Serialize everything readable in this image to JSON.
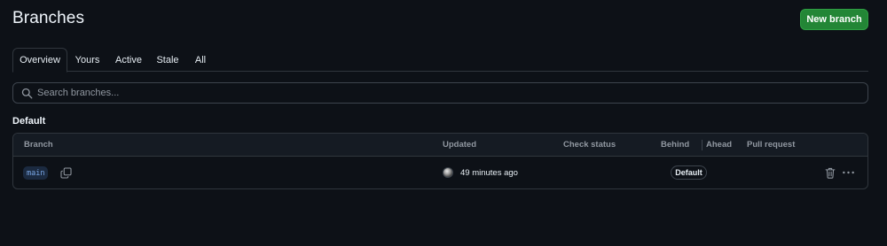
{
  "header": {
    "title": "Branches",
    "new_branch_label": "New branch"
  },
  "tabs": [
    {
      "label": "Overview",
      "selected": true
    },
    {
      "label": "Yours",
      "selected": false
    },
    {
      "label": "Active",
      "selected": false
    },
    {
      "label": "Stale",
      "selected": false
    },
    {
      "label": "All",
      "selected": false
    }
  ],
  "search": {
    "placeholder": "Search branches...",
    "value": ""
  },
  "section": {
    "title": "Default"
  },
  "table": {
    "columns": {
      "branch": "Branch",
      "updated": "Updated",
      "check_status": "Check status",
      "behind": "Behind",
      "ahead": "Ahead",
      "pull_request": "Pull request"
    },
    "rows": [
      {
        "branch": "main",
        "updated": "49 minutes ago",
        "badge": "Default"
      }
    ]
  },
  "colors": {
    "background": "#0d1117",
    "primary_button": "#238636",
    "border": "#30363d",
    "branch_chip_text": "#7aa7e6"
  },
  "icons": [
    "search-icon",
    "copy-icon",
    "trash-icon",
    "kebab-menu-icon",
    "avatar"
  ]
}
